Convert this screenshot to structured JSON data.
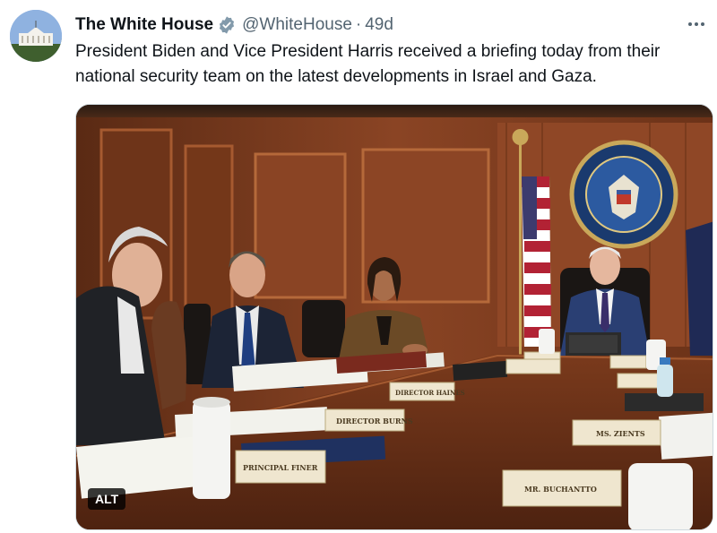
{
  "tweet": {
    "author": {
      "display_name": "The White House",
      "verified_icon": "verified-badge-icon",
      "handle": "@WhiteHouse",
      "separator": "·",
      "time": "49d"
    },
    "text": "President Biden and Vice President Harris received a briefing today from their national security team on the latest developments in Israel and Gaza.",
    "media": {
      "alt_badge": "ALT",
      "placards": [
        "DIRECTOR BURNS",
        "DIRECTOR HAINES",
        "PRINCIPAL FINER",
        "MS. ZIENTS",
        "MR. BUCHANTTO"
      ]
    },
    "more_icon": "more-options-icon"
  },
  "colors": {
    "text_primary": "#0f1419",
    "text_secondary": "#536471",
    "verified": "#829aab",
    "border": "#cfd9de"
  }
}
